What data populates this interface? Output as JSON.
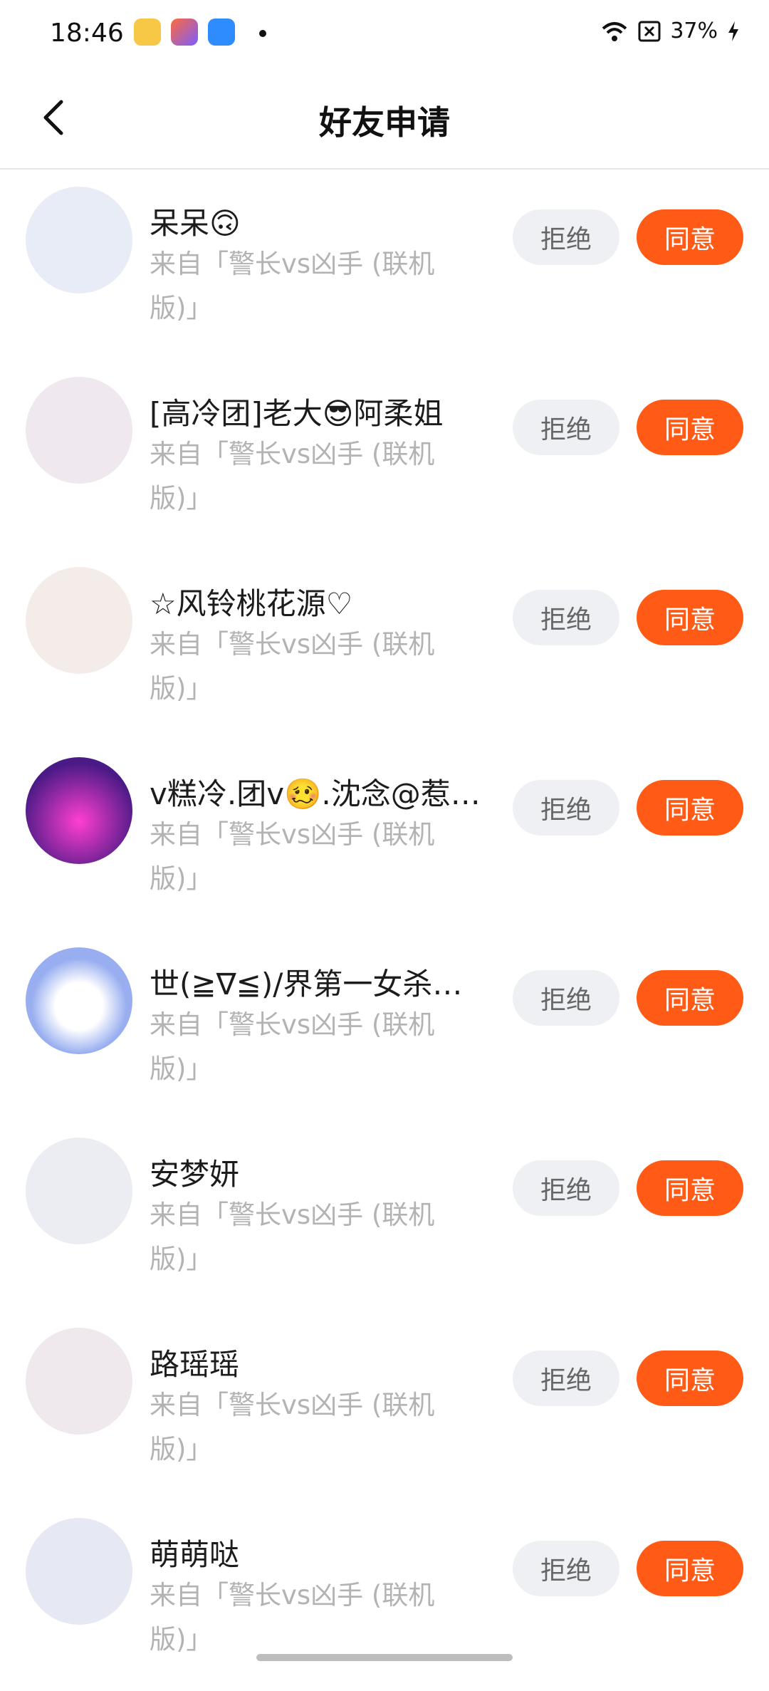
{
  "status_bar": {
    "time": "18:46",
    "battery": "37%",
    "icons": [
      "notes-app-icon",
      "shortcut-app-icon",
      "blue-app-icon",
      "wifi-icon",
      "sim-x-icon",
      "battery-charging-icon"
    ]
  },
  "header": {
    "title": "好友申请"
  },
  "requests": [
    {
      "name": "呆呆🙃",
      "from": "来自「警长vs凶手 (联机版)」",
      "reject": "拒绝",
      "accept": "同意",
      "avatar_color": "#e8ecf6"
    },
    {
      "name": "[高冷团]老大😎阿柔姐",
      "from": "来自「警长vs凶手 (联机版)」",
      "reject": "拒绝",
      "accept": "同意",
      "avatar_color": "#efe8ee"
    },
    {
      "name": "☆风铃桃花源♡",
      "from": "来自「警长vs凶手 (联机版)」",
      "reject": "拒绝",
      "accept": "同意",
      "avatar_color": "#f3ece8"
    },
    {
      "name": "v糕冷.团v🥴.沈念@惹…",
      "from": "来自「警长vs凶手 (联机版)」",
      "reject": "拒绝",
      "accept": "同意",
      "avatar_color": "#4a1a86"
    },
    {
      "name": "世(≧∇≦)/界第一女杀手…",
      "from": "来自「警长vs凶手 (联机版)」",
      "reject": "拒绝",
      "accept": "同意",
      "avatar_color": "#98aef0"
    },
    {
      "name": "安梦妍",
      "from": "来自「警长vs凶手 (联机版)」",
      "reject": "拒绝",
      "accept": "同意",
      "avatar_color": "#ecedf2"
    },
    {
      "name": "路瑶瑶",
      "from": "来自「警长vs凶手 (联机版)」",
      "reject": "拒绝",
      "accept": "同意",
      "avatar_color": "#efe8ec"
    },
    {
      "name": "萌萌哒",
      "from": "来自「警长vs凶手 (联机版)」",
      "reject": "拒绝",
      "accept": "同意",
      "avatar_color": "#e6e8f3"
    }
  ]
}
